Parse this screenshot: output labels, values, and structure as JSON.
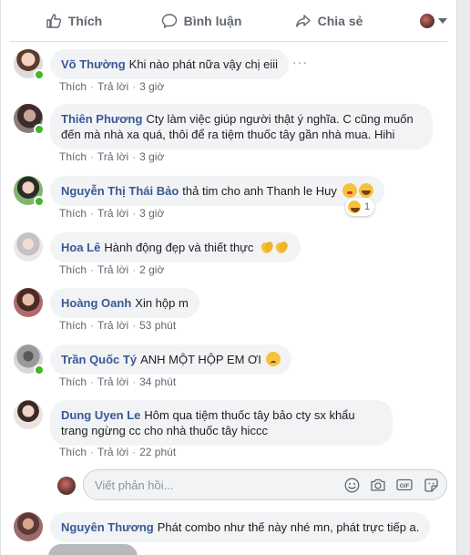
{
  "actions": {
    "like": "Thích",
    "comment": "Bình luận",
    "share": "Chia sẻ"
  },
  "comments": [
    {
      "name": "Võ Thường",
      "text": "Khi nào phát nữa vậy chị eiii",
      "like": "Thích",
      "reply": "Trả lời",
      "time": "3 giờ"
    },
    {
      "name": "Thiên Phương",
      "text": "Cty làm việc giúp người thật ý nghĩa. C cũng muốn đến mà nhà xa quá, thôi để ra tiệm thuốc tây gần nhà mua. Hihi",
      "like": "Thích",
      "reply": "Trả lời",
      "time": "3 giờ"
    },
    {
      "name": "Nguyễn Thị Thái Bảo",
      "text": "thả tim cho anh Thanh le Huy",
      "like": "Thích",
      "reply": "Trả lời",
      "time": "3 giờ",
      "reaction_count": "1"
    },
    {
      "name": "Hoa Lê",
      "text": "Hành động đẹp và thiết thực",
      "like": "Thích",
      "reply": "Trả lời",
      "time": "2 giờ"
    },
    {
      "name": "Hoàng Oanh",
      "text": "Xin hộp m",
      "like": "Thích",
      "reply": "Trả lời",
      "time": "53 phút"
    },
    {
      "name": "Trần Quốc Tý",
      "text": "ANH MỘT HỘP EM ƠI",
      "like": "Thích",
      "reply": "Trả lời",
      "time": "34 phút"
    },
    {
      "name": "Dung Uyen Le",
      "text": "Hôm qua tiệm thuốc tây bảo cty sx khẩu trang ngừng cc cho nhà thuốc tây hiccc",
      "like": "Thích",
      "reply": "Trả lời",
      "time": "22 phút"
    },
    {
      "name": "Nguyên Thương",
      "text": "Phát combo như thế này nhé mn, phát trực tiếp a."
    }
  ],
  "reply": {
    "placeholder": "Viết phản hồi..."
  },
  "colors": {
    "name_link": "#385898",
    "bubble_bg": "#f2f3f5",
    "online": "#42b72a",
    "meta_text": "#606770"
  }
}
